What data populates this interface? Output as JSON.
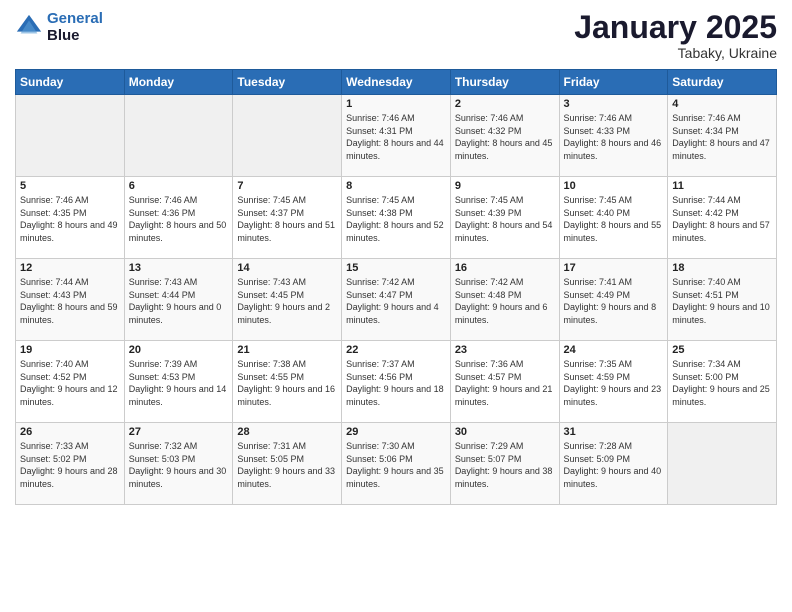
{
  "header": {
    "logo_line1": "General",
    "logo_line2": "Blue",
    "month": "January 2025",
    "location": "Tabaky, Ukraine"
  },
  "days_of_week": [
    "Sunday",
    "Monday",
    "Tuesday",
    "Wednesday",
    "Thursday",
    "Friday",
    "Saturday"
  ],
  "weeks": [
    [
      {
        "day": "",
        "sunrise": "",
        "sunset": "",
        "daylight": ""
      },
      {
        "day": "",
        "sunrise": "",
        "sunset": "",
        "daylight": ""
      },
      {
        "day": "",
        "sunrise": "",
        "sunset": "",
        "daylight": ""
      },
      {
        "day": "1",
        "sunrise": "Sunrise: 7:46 AM",
        "sunset": "Sunset: 4:31 PM",
        "daylight": "Daylight: 8 hours and 44 minutes."
      },
      {
        "day": "2",
        "sunrise": "Sunrise: 7:46 AM",
        "sunset": "Sunset: 4:32 PM",
        "daylight": "Daylight: 8 hours and 45 minutes."
      },
      {
        "day": "3",
        "sunrise": "Sunrise: 7:46 AM",
        "sunset": "Sunset: 4:33 PM",
        "daylight": "Daylight: 8 hours and 46 minutes."
      },
      {
        "day": "4",
        "sunrise": "Sunrise: 7:46 AM",
        "sunset": "Sunset: 4:34 PM",
        "daylight": "Daylight: 8 hours and 47 minutes."
      }
    ],
    [
      {
        "day": "5",
        "sunrise": "Sunrise: 7:46 AM",
        "sunset": "Sunset: 4:35 PM",
        "daylight": "Daylight: 8 hours and 49 minutes."
      },
      {
        "day": "6",
        "sunrise": "Sunrise: 7:46 AM",
        "sunset": "Sunset: 4:36 PM",
        "daylight": "Daylight: 8 hours and 50 minutes."
      },
      {
        "day": "7",
        "sunrise": "Sunrise: 7:45 AM",
        "sunset": "Sunset: 4:37 PM",
        "daylight": "Daylight: 8 hours and 51 minutes."
      },
      {
        "day": "8",
        "sunrise": "Sunrise: 7:45 AM",
        "sunset": "Sunset: 4:38 PM",
        "daylight": "Daylight: 8 hours and 52 minutes."
      },
      {
        "day": "9",
        "sunrise": "Sunrise: 7:45 AM",
        "sunset": "Sunset: 4:39 PM",
        "daylight": "Daylight: 8 hours and 54 minutes."
      },
      {
        "day": "10",
        "sunrise": "Sunrise: 7:45 AM",
        "sunset": "Sunset: 4:40 PM",
        "daylight": "Daylight: 8 hours and 55 minutes."
      },
      {
        "day": "11",
        "sunrise": "Sunrise: 7:44 AM",
        "sunset": "Sunset: 4:42 PM",
        "daylight": "Daylight: 8 hours and 57 minutes."
      }
    ],
    [
      {
        "day": "12",
        "sunrise": "Sunrise: 7:44 AM",
        "sunset": "Sunset: 4:43 PM",
        "daylight": "Daylight: 8 hours and 59 minutes."
      },
      {
        "day": "13",
        "sunrise": "Sunrise: 7:43 AM",
        "sunset": "Sunset: 4:44 PM",
        "daylight": "Daylight: 9 hours and 0 minutes."
      },
      {
        "day": "14",
        "sunrise": "Sunrise: 7:43 AM",
        "sunset": "Sunset: 4:45 PM",
        "daylight": "Daylight: 9 hours and 2 minutes."
      },
      {
        "day": "15",
        "sunrise": "Sunrise: 7:42 AM",
        "sunset": "Sunset: 4:47 PM",
        "daylight": "Daylight: 9 hours and 4 minutes."
      },
      {
        "day": "16",
        "sunrise": "Sunrise: 7:42 AM",
        "sunset": "Sunset: 4:48 PM",
        "daylight": "Daylight: 9 hours and 6 minutes."
      },
      {
        "day": "17",
        "sunrise": "Sunrise: 7:41 AM",
        "sunset": "Sunset: 4:49 PM",
        "daylight": "Daylight: 9 hours and 8 minutes."
      },
      {
        "day": "18",
        "sunrise": "Sunrise: 7:40 AM",
        "sunset": "Sunset: 4:51 PM",
        "daylight": "Daylight: 9 hours and 10 minutes."
      }
    ],
    [
      {
        "day": "19",
        "sunrise": "Sunrise: 7:40 AM",
        "sunset": "Sunset: 4:52 PM",
        "daylight": "Daylight: 9 hours and 12 minutes."
      },
      {
        "day": "20",
        "sunrise": "Sunrise: 7:39 AM",
        "sunset": "Sunset: 4:53 PM",
        "daylight": "Daylight: 9 hours and 14 minutes."
      },
      {
        "day": "21",
        "sunrise": "Sunrise: 7:38 AM",
        "sunset": "Sunset: 4:55 PM",
        "daylight": "Daylight: 9 hours and 16 minutes."
      },
      {
        "day": "22",
        "sunrise": "Sunrise: 7:37 AM",
        "sunset": "Sunset: 4:56 PM",
        "daylight": "Daylight: 9 hours and 18 minutes."
      },
      {
        "day": "23",
        "sunrise": "Sunrise: 7:36 AM",
        "sunset": "Sunset: 4:57 PM",
        "daylight": "Daylight: 9 hours and 21 minutes."
      },
      {
        "day": "24",
        "sunrise": "Sunrise: 7:35 AM",
        "sunset": "Sunset: 4:59 PM",
        "daylight": "Daylight: 9 hours and 23 minutes."
      },
      {
        "day": "25",
        "sunrise": "Sunrise: 7:34 AM",
        "sunset": "Sunset: 5:00 PM",
        "daylight": "Daylight: 9 hours and 25 minutes."
      }
    ],
    [
      {
        "day": "26",
        "sunrise": "Sunrise: 7:33 AM",
        "sunset": "Sunset: 5:02 PM",
        "daylight": "Daylight: 9 hours and 28 minutes."
      },
      {
        "day": "27",
        "sunrise": "Sunrise: 7:32 AM",
        "sunset": "Sunset: 5:03 PM",
        "daylight": "Daylight: 9 hours and 30 minutes."
      },
      {
        "day": "28",
        "sunrise": "Sunrise: 7:31 AM",
        "sunset": "Sunset: 5:05 PM",
        "daylight": "Daylight: 9 hours and 33 minutes."
      },
      {
        "day": "29",
        "sunrise": "Sunrise: 7:30 AM",
        "sunset": "Sunset: 5:06 PM",
        "daylight": "Daylight: 9 hours and 35 minutes."
      },
      {
        "day": "30",
        "sunrise": "Sunrise: 7:29 AM",
        "sunset": "Sunset: 5:07 PM",
        "daylight": "Daylight: 9 hours and 38 minutes."
      },
      {
        "day": "31",
        "sunrise": "Sunrise: 7:28 AM",
        "sunset": "Sunset: 5:09 PM",
        "daylight": "Daylight: 9 hours and 40 minutes."
      },
      {
        "day": "",
        "sunrise": "",
        "sunset": "",
        "daylight": ""
      }
    ]
  ]
}
